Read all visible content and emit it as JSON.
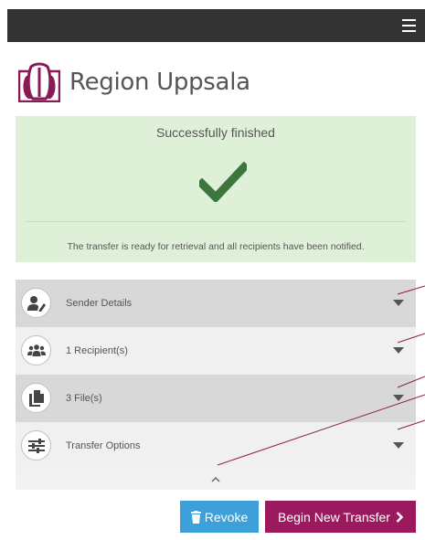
{
  "app": {
    "brand_name": "Region Uppsala",
    "brand_color": "#8a1a55",
    "menu_icon": "hamburger-menu-icon"
  },
  "status": {
    "title": "Successfully finished",
    "message": "The transfer is ready for retrieval and all recipients have been notified.",
    "icon": "checkmark-icon",
    "accent": "#3c763d",
    "background": "#dff0d8"
  },
  "panels": [
    {
      "label": "Sender Details",
      "icon": "user-edit-icon",
      "state": "collapsed"
    },
    {
      "label": "1 Recipient(s)",
      "icon": "users-icon",
      "state": "collapsed"
    },
    {
      "label": "3 File(s)",
      "icon": "files-icon",
      "state": "collapsed"
    },
    {
      "label": "Transfer Options",
      "icon": "sliders-icon",
      "state": "collapsed"
    }
  ],
  "actions": {
    "revoke_label": "Revoke",
    "revoke_color": "#3ea0d8",
    "new_transfer_label": "Begin New Transfer",
    "new_transfer_color": "#9b1a5e"
  }
}
